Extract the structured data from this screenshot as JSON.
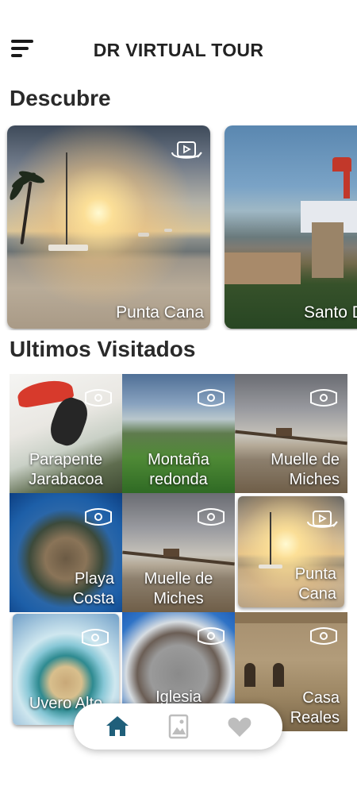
{
  "app": {
    "title": "DR VIRTUAL TOUR"
  },
  "sections": {
    "discover_title": "Descubre",
    "recent_title": "Ultimos Visitados"
  },
  "discover": [
    {
      "label": "Punta Cana",
      "icon": "360-video-icon"
    },
    {
      "label": "Santo D",
      "icon": "360-video-icon"
    }
  ],
  "recent": [
    {
      "label": "Parapente\nJarabacoa",
      "icon": "vr-headset-icon"
    },
    {
      "label": "Montaña\nredonda",
      "icon": "vr-headset-icon"
    },
    {
      "label": "Muelle de\nMiches",
      "icon": "vr-headset-icon"
    },
    {
      "label": "Playa\nCosta",
      "icon": "vr-headset-icon"
    },
    {
      "label": "Muelle de\nMiches",
      "icon": "vr-headset-icon"
    },
    {
      "label": "Punta\nCana",
      "icon": "360-video-icon"
    },
    {
      "label": "Uvero Alto",
      "icon": "vr-headset-icon"
    },
    {
      "label": "Iglesia",
      "icon": "vr-headset-icon"
    },
    {
      "label": "Casa\nReales",
      "icon": "vr-headset-icon"
    }
  ],
  "nav": {
    "items": [
      "home-icon",
      "gallery-icon",
      "heart-icon"
    ],
    "active": "home-icon",
    "active_color": "#1f5f7a",
    "inactive_color": "#bdbdbd"
  }
}
